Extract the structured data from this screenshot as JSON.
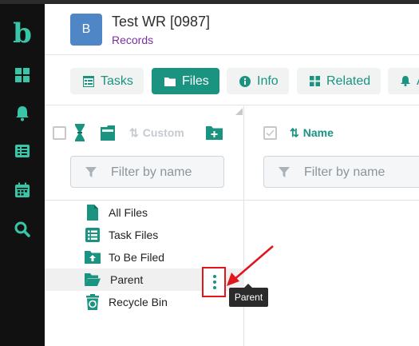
{
  "app": {
    "logo": "b"
  },
  "rail": {
    "icons": [
      "dashboard-icon",
      "bell-icon",
      "list-icon",
      "calendar-icon",
      "search-icon"
    ]
  },
  "record": {
    "avatar": "B",
    "title": "Test WR [0987]",
    "subtitle": "Records"
  },
  "tabs": [
    {
      "label": "Tasks",
      "icon": "table-icon",
      "active": false
    },
    {
      "label": "Files",
      "icon": "folder-icon",
      "active": true
    },
    {
      "label": "Info",
      "icon": "info-icon",
      "active": false
    },
    {
      "label": "Related",
      "icon": "grid-icon",
      "active": false
    },
    {
      "label": "A",
      "icon": "bell-icon",
      "active": false
    }
  ],
  "left_panel": {
    "sort_label": "Custom",
    "filter_placeholder": "Filter by name",
    "folders": [
      {
        "label": "All Files",
        "icon": "file-icon"
      },
      {
        "label": "Task Files",
        "icon": "list-icon"
      },
      {
        "label": "To Be Filed",
        "icon": "folder-upload-icon"
      },
      {
        "label": "Parent",
        "icon": "folder-open-icon",
        "selected": true
      },
      {
        "label": "Recycle Bin",
        "icon": "recycle-icon"
      }
    ]
  },
  "right_panel": {
    "sort_label": "Name",
    "filter_placeholder": "Filter by name"
  },
  "tooltip": "Parent",
  "colors": {
    "accent": "#1a9481",
    "rail_icon": "#37c6a7",
    "highlight": "#e0161b",
    "subtitle": "#7a2fa0"
  }
}
